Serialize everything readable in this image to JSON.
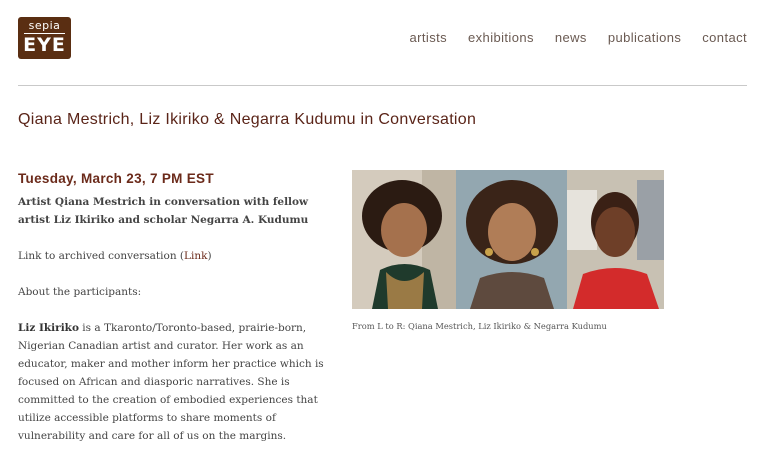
{
  "logo": {
    "top": "sepia",
    "bottom": "EYE"
  },
  "nav": [
    "artists",
    "exhibitions",
    "news",
    "publications",
    "contact"
  ],
  "title": "Qiana Mestrich, Liz Ikiriko & Negarra Kudumu in Conversation",
  "event": {
    "date": "Tuesday, March 23, 7 PM EST",
    "lede": "Artist Qiana Mestrich in conversation with fellow artist Liz Ikiriko and scholar Negarra A. Kudumu",
    "link_prefix": "Link to archived conversation (",
    "link_text": "Link",
    "link_suffix": ")",
    "about": "About the participants:",
    "bio_name": "Liz Ikiriko",
    "bio_text": " is a Tkaronto/Toronto-based, prairie-born, Nigerian Canadian artist and curator. Her work as an educator, maker and mother inform her practice which is focused on African and diasporic narratives. She is committed to the creation of embodied experiences that utilize accessible platforms to share moments of vulnerability and care for all of us on the margins."
  },
  "photo": {
    "caption": "From L to R: Qiana Mestrich, Liz Ikiriko & Negarra Kudumu"
  },
  "colors": {
    "brand": "#5a2e12",
    "accent": "#6b2a1a"
  }
}
